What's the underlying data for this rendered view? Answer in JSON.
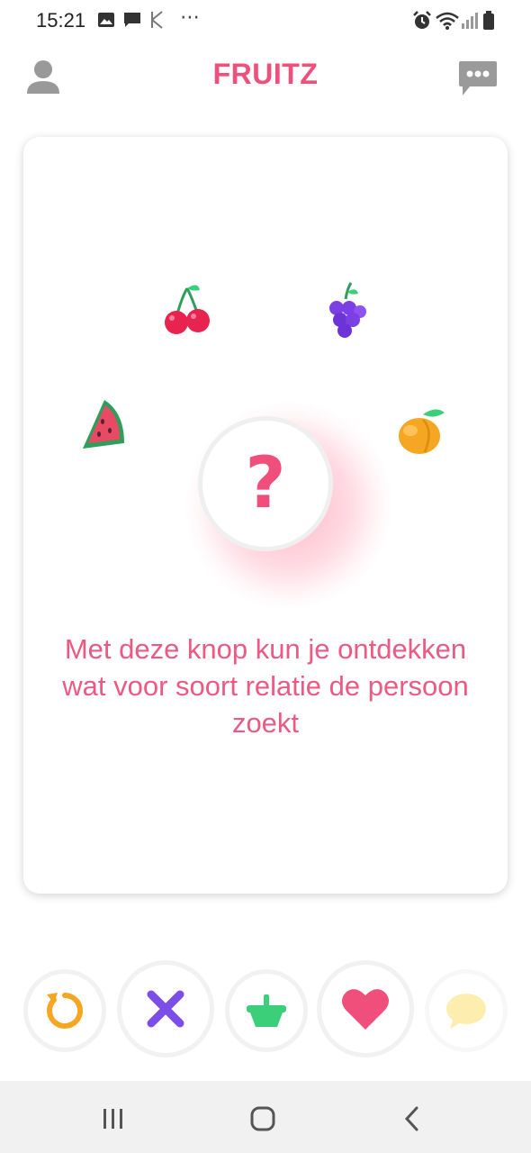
{
  "status_bar": {
    "time": "15:21",
    "left_icons": [
      "image-icon",
      "message-icon",
      "app-k-icon",
      "more-dots-icon"
    ],
    "right_icons": [
      "alarm-icon",
      "wifi-icon",
      "signal-icon",
      "battery-icon"
    ],
    "dots": "⋯"
  },
  "header": {
    "title": "FRUITZ",
    "brand_color": "#f04e7b"
  },
  "card": {
    "fruits": [
      "cherry-icon",
      "grapes-icon",
      "watermelon-icon",
      "peach-icon"
    ],
    "center_button": "?",
    "hint": "Met deze knop kun je ontdekken wat voor soort relatie de persoon zoekt"
  },
  "actions": [
    "undo-button",
    "dislike-button",
    "basket-button",
    "like-button",
    "message-button"
  ],
  "colors": {
    "undo": "#f5a623",
    "dislike": "#7b4ee8",
    "basket": "#3ccf7a",
    "like": "#f04e7b",
    "message": "#fdeeb0"
  },
  "nav": [
    "recent-apps-button",
    "home-button",
    "back-button"
  ]
}
